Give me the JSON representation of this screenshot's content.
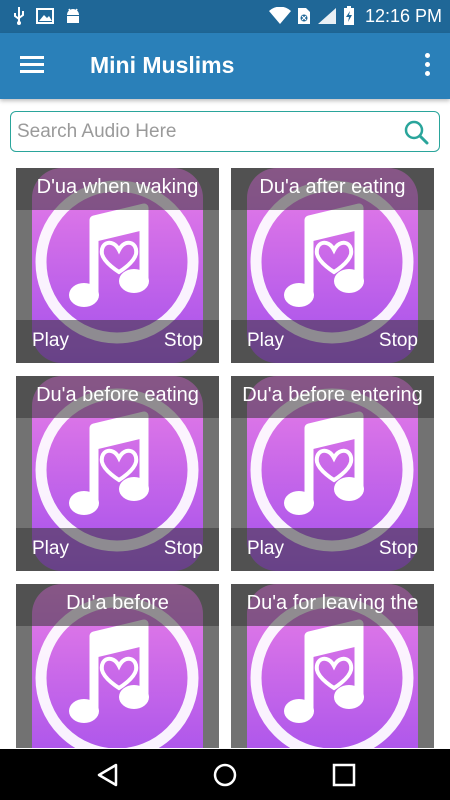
{
  "status_bar": {
    "time": "12:16 PM",
    "icons": [
      "usb-icon",
      "image-icon",
      "android-icon",
      "wifi-icon",
      "sim-icon",
      "signal-icon",
      "battery-charging-icon"
    ]
  },
  "app_bar": {
    "title": "Mini Muslims",
    "menu_icon": "hamburger-menu-icon",
    "overflow_icon": "more-vert-icon"
  },
  "search": {
    "placeholder": "Search Audio Here",
    "value": "",
    "icon": "search-icon"
  },
  "colors": {
    "status_bar": "#1f6797",
    "app_bar": "#2a80b9",
    "search_border": "#2aa59b",
    "tile_gradient_top": "#e97ee6",
    "tile_gradient_bottom": "#a450ec"
  },
  "cards": [
    {
      "title": "D'ua when waking",
      "play_label": "Play",
      "stop_label": "Stop",
      "icon": "music-note-heart-icon"
    },
    {
      "title": "Du'a after eating",
      "play_label": "Play",
      "stop_label": "Stop",
      "icon": "music-note-heart-icon"
    },
    {
      "title": "Du'a before eating",
      "play_label": "Play",
      "stop_label": "Stop",
      "icon": "music-note-heart-icon"
    },
    {
      "title": "Du'a before entering",
      "play_label": "Play",
      "stop_label": "Stop",
      "icon": "music-note-heart-icon"
    },
    {
      "title": "Du'a before",
      "play_label": "",
      "stop_label": "",
      "icon": "music-note-heart-icon"
    },
    {
      "title": "Du'a for leaving the",
      "play_label": "",
      "stop_label": "",
      "icon": "music-note-heart-icon"
    }
  ],
  "nav_bar": {
    "icons": [
      "back-icon",
      "home-icon",
      "recents-icon"
    ]
  }
}
